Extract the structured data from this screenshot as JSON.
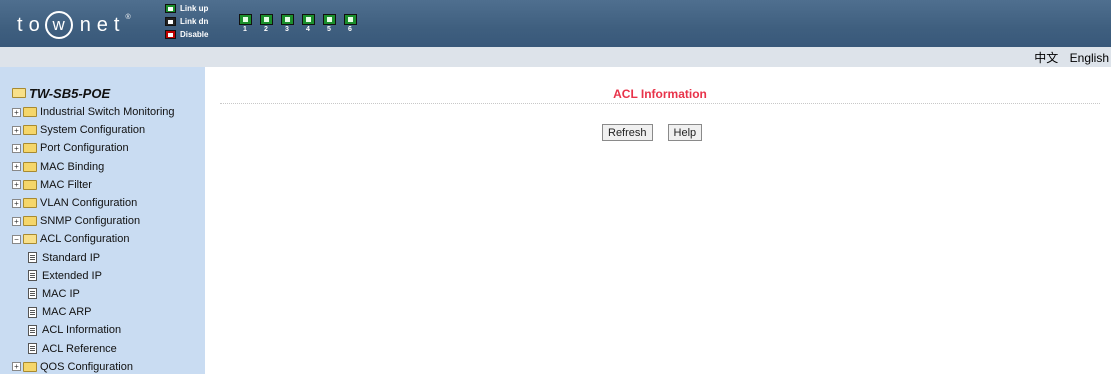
{
  "header": {
    "logo": {
      "t": "t",
      "o": "o",
      "w": "w",
      "rest": "net",
      "mark": "®"
    },
    "legend": [
      {
        "label": "Link up",
        "state": "up"
      },
      {
        "label": "Link dn",
        "state": "dn"
      },
      {
        "label": "Disable",
        "state": "dis"
      }
    ],
    "ports": [
      "1",
      "2",
      "3",
      "4",
      "5",
      "6"
    ]
  },
  "lang": {
    "chinese": "中文",
    "english": "English"
  },
  "tree": {
    "root": "TW-SB5-POE",
    "items": [
      {
        "label": "Industrial Switch Monitoring"
      },
      {
        "label": "System Configuration"
      },
      {
        "label": "Port Configuration"
      },
      {
        "label": "MAC Binding"
      },
      {
        "label": "MAC Filter"
      },
      {
        "label": "VLAN Configuration"
      },
      {
        "label": "SNMP Configuration"
      },
      {
        "label": "ACL Configuration"
      },
      {
        "label": "QOS Configuration"
      }
    ],
    "acl_children": [
      {
        "label": "Standard IP"
      },
      {
        "label": "Extended IP"
      },
      {
        "label": "MAC IP"
      },
      {
        "label": "MAC ARP"
      },
      {
        "label": "ACL Information"
      },
      {
        "label": "ACL Reference"
      }
    ]
  },
  "main": {
    "title": "ACL Information",
    "refresh_label": "Refresh",
    "help_label": "Help"
  },
  "colors": {
    "topbar": "#3f5f7f",
    "sidebar": "#c9dcf2",
    "title": "#e8334a",
    "link_up": "#1b8f2c",
    "disable": "#c00000"
  }
}
